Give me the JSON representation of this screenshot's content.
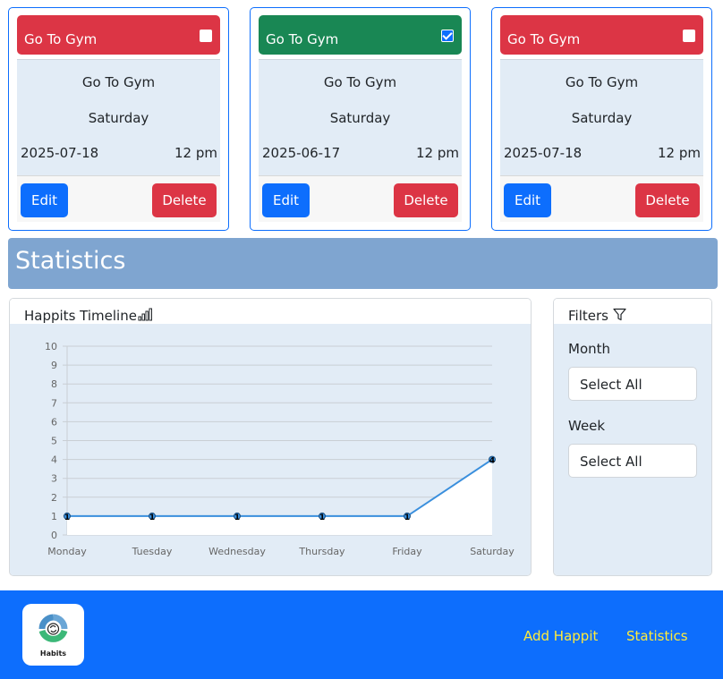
{
  "cards": [
    {
      "header": "Go To Gym",
      "checked": false,
      "status": "red",
      "name": "Go To Gym",
      "day": "Saturday",
      "date": "2025-07-18",
      "time": "12 pm",
      "edit": "Edit",
      "delete": "Delete"
    },
    {
      "header": "Go To Gym",
      "checked": true,
      "status": "green",
      "name": "Go To Gym",
      "day": "Saturday",
      "date": "2025-06-17",
      "time": "12 pm",
      "edit": "Edit",
      "delete": "Delete"
    },
    {
      "header": "Go To Gym",
      "checked": false,
      "status": "red",
      "name": "Go To Gym",
      "day": "Saturday",
      "date": "2025-07-18",
      "time": "12 pm",
      "edit": "Edit",
      "delete": "Delete"
    }
  ],
  "colors": {
    "red": "#dc3545",
    "green": "#198754",
    "primary": "#0d6efd",
    "banner": "#7fa5d0",
    "line": "#3a8fdd",
    "nav_link": "#ffeb3b"
  },
  "statistics": {
    "title": "Statistics"
  },
  "timeline": {
    "title": "Happits Timeline",
    "icon": "bar-chart-icon"
  },
  "filters": {
    "title": "Filters",
    "icon": "funnel-icon",
    "month_label": "Month",
    "month_value": "Select All",
    "week_label": "Week",
    "week_value": "Select All"
  },
  "chart_data": {
    "type": "line",
    "categories": [
      "Monday",
      "Tuesday",
      "Wednesday",
      "Thursday",
      "Friday",
      "Saturday"
    ],
    "series": [
      {
        "values": [
          1,
          1,
          1,
          1,
          1,
          4
        ]
      }
    ],
    "data_labels": [
      "1",
      "1",
      "1",
      "1",
      "1",
      "4"
    ],
    "yticks": [
      "0",
      "1",
      "2",
      "3",
      "4",
      "5",
      "6",
      "7",
      "8",
      "9",
      "10"
    ],
    "ylim": [
      0,
      10
    ],
    "grid": true
  },
  "footer": {
    "logo_text": "Habits",
    "nav": [
      "Add Happit",
      "Statistics"
    ]
  }
}
